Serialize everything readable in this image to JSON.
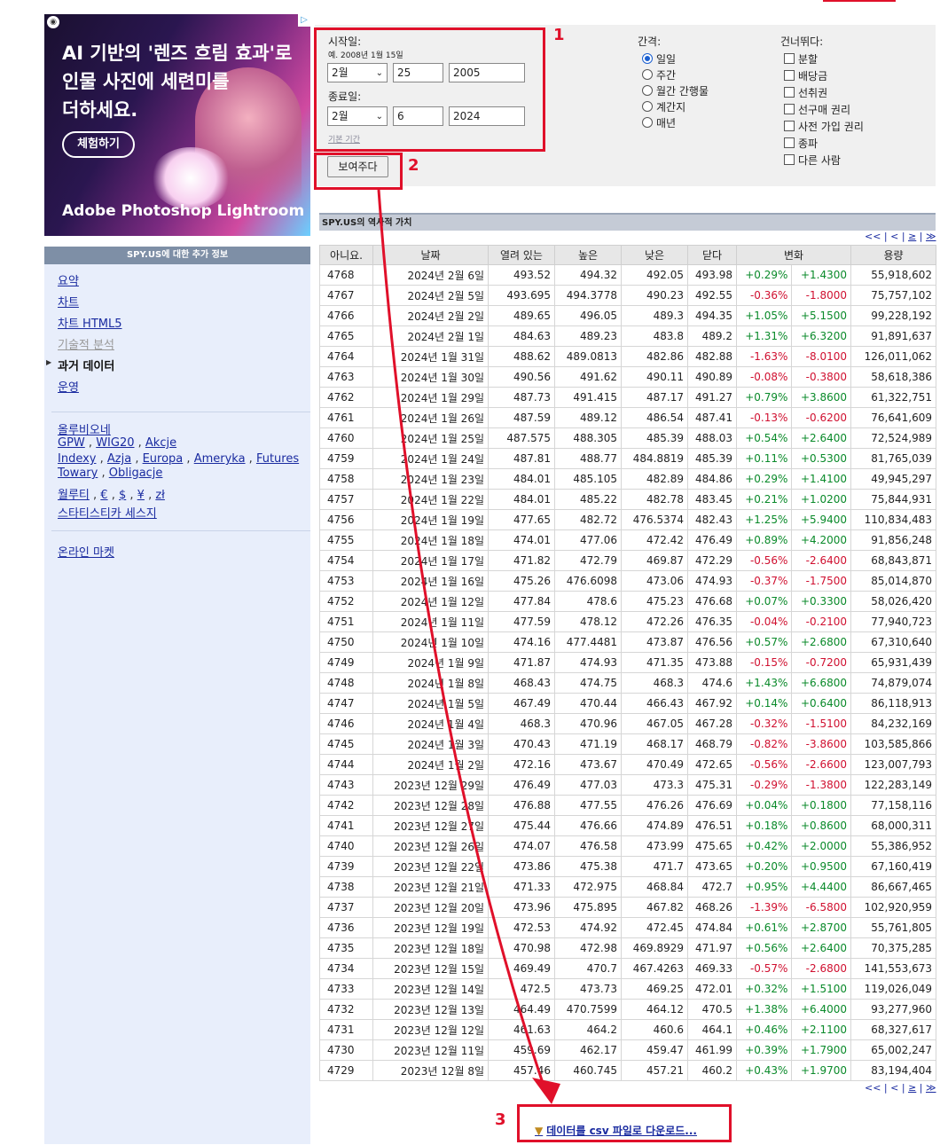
{
  "ad": {
    "headline": [
      "AI 기반의 '렌즈 흐림 효과'로",
      "인물 사진에 세련미를",
      "더하세요."
    ],
    "cta": "체험하기",
    "brand": "Adobe Photoshop Lightroom",
    "ad_choice_icon": "ad-choices-icon"
  },
  "sidebar": {
    "title": "SPY.US에 대한 추가 정보",
    "items": [
      {
        "label": "요약",
        "state": "link"
      },
      {
        "label": "차트",
        "state": "link"
      },
      {
        "label": "차트 HTML5",
        "state": "link"
      },
      {
        "label": "기술적 분석",
        "state": "disabled"
      },
      {
        "label": "과거 데이터",
        "state": "active"
      },
      {
        "label": "운영",
        "state": "link"
      }
    ],
    "group2": {
      "line1": "올루비오네",
      "line2": [
        "GPW",
        "WIG20",
        "Akcje"
      ],
      "line3": [
        "Indexy",
        "Azja",
        "Europa",
        "Ameryka",
        "Futures"
      ],
      "line4": [
        "Towary",
        "Obligacje"
      ],
      "line5": [
        "월루티",
        "€",
        "$",
        "¥",
        "zł"
      ],
      "line6": "스타티스티카 세스지"
    },
    "group3": "온라인 마켓"
  },
  "form": {
    "start_label": "시작일:",
    "example": "예. 2008년 1월 15일",
    "start_month": "2월",
    "start_day": "25",
    "start_year": "2005",
    "end_label": "종료일:",
    "end_month": "2월",
    "end_day": "6",
    "end_year": "2024",
    "default_period": "기본 기간",
    "submit": "보여주다",
    "interval_label": "간격:",
    "intervals": [
      "일일",
      "주간",
      "월간 간행물",
      "계간지",
      "매년"
    ],
    "selected_interval": "일일",
    "skip_label": "건너뛰다:",
    "skips": [
      "분할",
      "배당금",
      "선취권",
      "선구매 권리",
      "사전 가입 권리",
      "종파",
      "다른 사람"
    ]
  },
  "annotations": {
    "box1": "1",
    "box2": "2",
    "box3": "3",
    "color": "#e0102a"
  },
  "table": {
    "title": "SPY.US의 역사적 가치",
    "pager": [
      "<<",
      "<",
      "≥",
      "≫"
    ],
    "headers": [
      "아니요.",
      "날짜",
      "열려 있는",
      "높은",
      "낮은",
      "닫다",
      "변화",
      "용량"
    ],
    "rows": [
      [
        "4768",
        "2024년 2월 6일",
        "493.52",
        "494.32",
        "492.05",
        "493.98",
        "+0.29%",
        "+1.4300",
        "55,918,602"
      ],
      [
        "4767",
        "2024년 2월 5일",
        "493.695",
        "494.3778",
        "490.23",
        "492.55",
        "-0.36%",
        "-1.8000",
        "75,757,102"
      ],
      [
        "4766",
        "2024년 2월 2일",
        "489.65",
        "496.05",
        "489.3",
        "494.35",
        "+1.05%",
        "+5.1500",
        "99,228,192"
      ],
      [
        "4765",
        "2024년 2월 1일",
        "484.63",
        "489.23",
        "483.8",
        "489.2",
        "+1.31%",
        "+6.3200",
        "91,891,637"
      ],
      [
        "4764",
        "2024년 1월 31일",
        "488.62",
        "489.0813",
        "482.86",
        "482.88",
        "-1.63%",
        "-8.0100",
        "126,011,062"
      ],
      [
        "4763",
        "2024년 1월 30일",
        "490.56",
        "491.62",
        "490.11",
        "490.89",
        "-0.08%",
        "-0.3800",
        "58,618,386"
      ],
      [
        "4762",
        "2024년 1월 29일",
        "487.73",
        "491.415",
        "487.17",
        "491.27",
        "+0.79%",
        "+3.8600",
        "61,322,751"
      ],
      [
        "4761",
        "2024년 1월 26일",
        "487.59",
        "489.12",
        "486.54",
        "487.41",
        "-0.13%",
        "-0.6200",
        "76,641,609"
      ],
      [
        "4760",
        "2024년 1월 25일",
        "487.575",
        "488.305",
        "485.39",
        "488.03",
        "+0.54%",
        "+2.6400",
        "72,524,989"
      ],
      [
        "4759",
        "2024년 1월 24일",
        "487.81",
        "488.77",
        "484.8819",
        "485.39",
        "+0.11%",
        "+0.5300",
        "81,765,039"
      ],
      [
        "4758",
        "2024년 1월 23일",
        "484.01",
        "485.105",
        "482.89",
        "484.86",
        "+0.29%",
        "+1.4100",
        "49,945,297"
      ],
      [
        "4757",
        "2024년 1월 22일",
        "484.01",
        "485.22",
        "482.78",
        "483.45",
        "+0.21%",
        "+1.0200",
        "75,844,931"
      ],
      [
        "4756",
        "2024년 1월 19일",
        "477.65",
        "482.72",
        "476.5374",
        "482.43",
        "+1.25%",
        "+5.9400",
        "110,834,483"
      ],
      [
        "4755",
        "2024년 1월 18일",
        "474.01",
        "477.06",
        "472.42",
        "476.49",
        "+0.89%",
        "+4.2000",
        "91,856,248"
      ],
      [
        "4754",
        "2024년 1월 17일",
        "471.82",
        "472.79",
        "469.87",
        "472.29",
        "-0.56%",
        "-2.6400",
        "68,843,871"
      ],
      [
        "4753",
        "2024년 1월 16일",
        "475.26",
        "476.6098",
        "473.06",
        "474.93",
        "-0.37%",
        "-1.7500",
        "85,014,870"
      ],
      [
        "4752",
        "2024년 1월 12일",
        "477.84",
        "478.6",
        "475.23",
        "476.68",
        "+0.07%",
        "+0.3300",
        "58,026,420"
      ],
      [
        "4751",
        "2024년 1월 11일",
        "477.59",
        "478.12",
        "472.26",
        "476.35",
        "-0.04%",
        "-0.2100",
        "77,940,723"
      ],
      [
        "4750",
        "2024년 1월 10일",
        "474.16",
        "477.4481",
        "473.87",
        "476.56",
        "+0.57%",
        "+2.6800",
        "67,310,640"
      ],
      [
        "4749",
        "2024년 1월 9일",
        "471.87",
        "474.93",
        "471.35",
        "473.88",
        "-0.15%",
        "-0.7200",
        "65,931,439"
      ],
      [
        "4748",
        "2024년 1월 8일",
        "468.43",
        "474.75",
        "468.3",
        "474.6",
        "+1.43%",
        "+6.6800",
        "74,879,074"
      ],
      [
        "4747",
        "2024년 1월 5일",
        "467.49",
        "470.44",
        "466.43",
        "467.92",
        "+0.14%",
        "+0.6400",
        "86,118,913"
      ],
      [
        "4746",
        "2024년 1월 4일",
        "468.3",
        "470.96",
        "467.05",
        "467.28",
        "-0.32%",
        "-1.5100",
        "84,232,169"
      ],
      [
        "4745",
        "2024년 1월 3일",
        "470.43",
        "471.19",
        "468.17",
        "468.79",
        "-0.82%",
        "-3.8600",
        "103,585,866"
      ],
      [
        "4744",
        "2024년 1월 2일",
        "472.16",
        "473.67",
        "470.49",
        "472.65",
        "-0.56%",
        "-2.6600",
        "123,007,793"
      ],
      [
        "4743",
        "2023년 12월 29일",
        "476.49",
        "477.03",
        "473.3",
        "475.31",
        "-0.29%",
        "-1.3800",
        "122,283,149"
      ],
      [
        "4742",
        "2023년 12월 28일",
        "476.88",
        "477.55",
        "476.26",
        "476.69",
        "+0.04%",
        "+0.1800",
        "77,158,116"
      ],
      [
        "4741",
        "2023년 12월 27일",
        "475.44",
        "476.66",
        "474.89",
        "476.51",
        "+0.18%",
        "+0.8600",
        "68,000,311"
      ],
      [
        "4740",
        "2023년 12월 26일",
        "474.07",
        "476.58",
        "473.99",
        "475.65",
        "+0.42%",
        "+2.0000",
        "55,386,952"
      ],
      [
        "4739",
        "2023년 12월 22일",
        "473.86",
        "475.38",
        "471.7",
        "473.65",
        "+0.20%",
        "+0.9500",
        "67,160,419"
      ],
      [
        "4738",
        "2023년 12월 21일",
        "471.33",
        "472.975",
        "468.84",
        "472.7",
        "+0.95%",
        "+4.4400",
        "86,667,465"
      ],
      [
        "4737",
        "2023년 12월 20일",
        "473.96",
        "475.895",
        "467.82",
        "468.26",
        "-1.39%",
        "-6.5800",
        "102,920,959"
      ],
      [
        "4736",
        "2023년 12월 19일",
        "472.53",
        "474.92",
        "472.45",
        "474.84",
        "+0.61%",
        "+2.8700",
        "55,761,805"
      ],
      [
        "4735",
        "2023년 12월 18일",
        "470.98",
        "472.98",
        "469.8929",
        "471.97",
        "+0.56%",
        "+2.6400",
        "70,375,285"
      ],
      [
        "4734",
        "2023년 12월 15일",
        "469.49",
        "470.7",
        "467.4263",
        "469.33",
        "-0.57%",
        "-2.6800",
        "141,553,673"
      ],
      [
        "4733",
        "2023년 12월 14일",
        "472.5",
        "473.73",
        "469.25",
        "472.01",
        "+0.32%",
        "+1.5100",
        "119,026,049"
      ],
      [
        "4732",
        "2023년 12월 13일",
        "464.49",
        "470.7599",
        "464.12",
        "470.5",
        "+1.38%",
        "+6.4000",
        "93,277,960"
      ],
      [
        "4731",
        "2023년 12월 12일",
        "461.63",
        "464.2",
        "460.6",
        "464.1",
        "+0.46%",
        "+2.1100",
        "68,327,617"
      ],
      [
        "4730",
        "2023년 12월 11일",
        "459.69",
        "462.17",
        "459.47",
        "461.99",
        "+0.39%",
        "+1.7900",
        "65,002,247"
      ],
      [
        "4729",
        "2023년 12월 8일",
        "457.46",
        "460.745",
        "457.21",
        "460.2",
        "+0.43%",
        "+1.9700",
        "83,194,404"
      ]
    ]
  },
  "csv_link": "데이터를 csv 파일로 다운로드..."
}
